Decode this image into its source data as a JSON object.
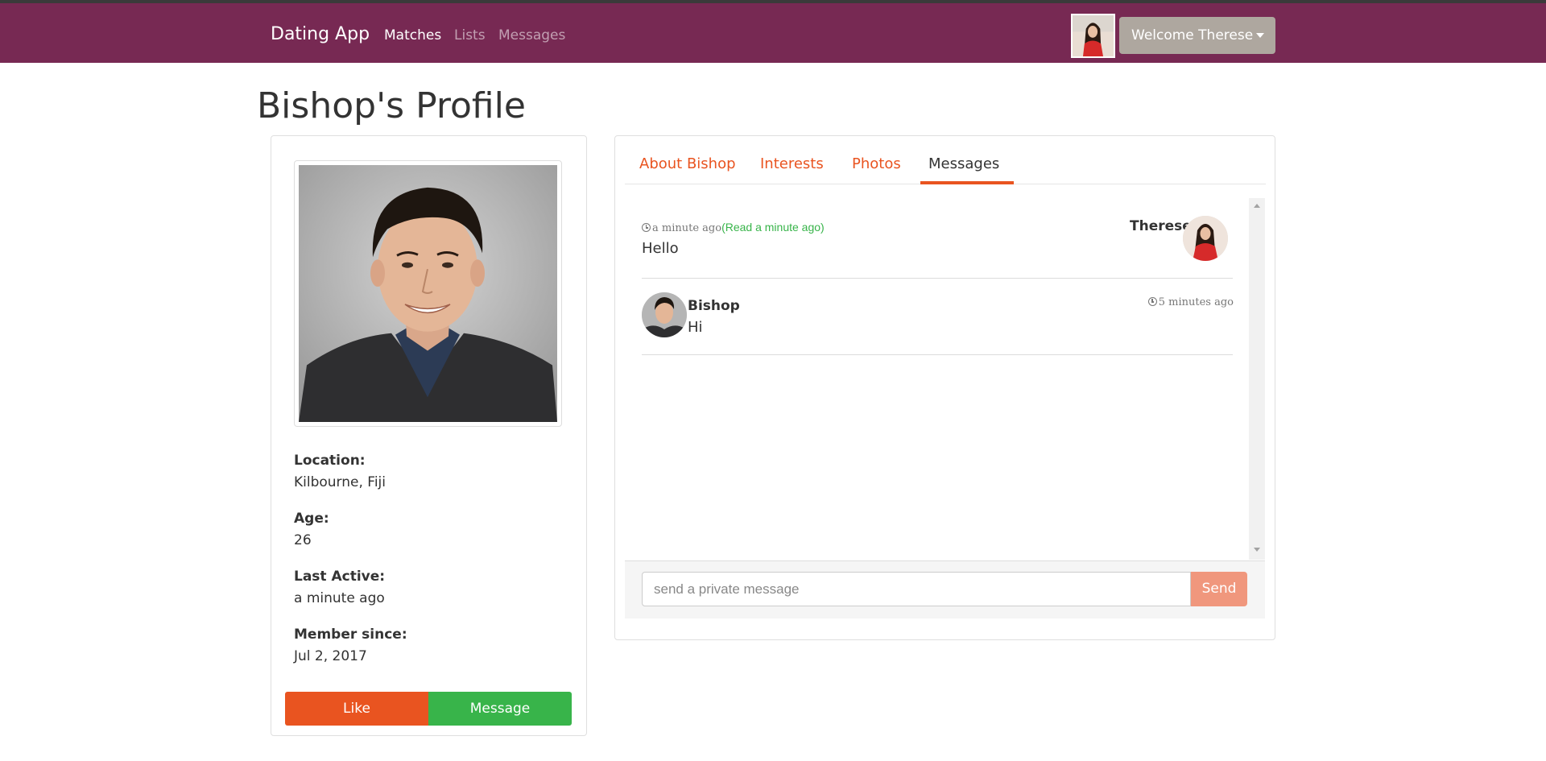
{
  "navbar": {
    "brand": "Dating App",
    "links": [
      "Matches",
      "Lists",
      "Messages"
    ],
    "welcome": "Welcome Therese"
  },
  "page": {
    "title": "Bishop's Profile"
  },
  "profile": {
    "location_label": "Location:",
    "location": "Kilbourne, Fiji",
    "age_label": "Age:",
    "age": "26",
    "last_active_label": "Last Active:",
    "last_active": "a minute ago",
    "member_since_label": "Member since:",
    "member_since": "Jul 2, 2017",
    "like_label": "Like",
    "message_label": "Message"
  },
  "tabs": [
    "About Bishop",
    "Interests",
    "Photos",
    "Messages"
  ],
  "messages": [
    {
      "author": "Therese",
      "time": "a minute ago",
      "read_status": "(Read a minute ago)",
      "text": "Hello"
    },
    {
      "author": "Bishop",
      "time": "5 minutes ago",
      "text": "Hi"
    }
  ],
  "composer": {
    "placeholder": "send a private message",
    "send_label": "Send"
  },
  "colors": {
    "navbar": "#772953",
    "accent": "#e95420",
    "success": "#38b44a",
    "welcome_button": "#aea79f"
  }
}
